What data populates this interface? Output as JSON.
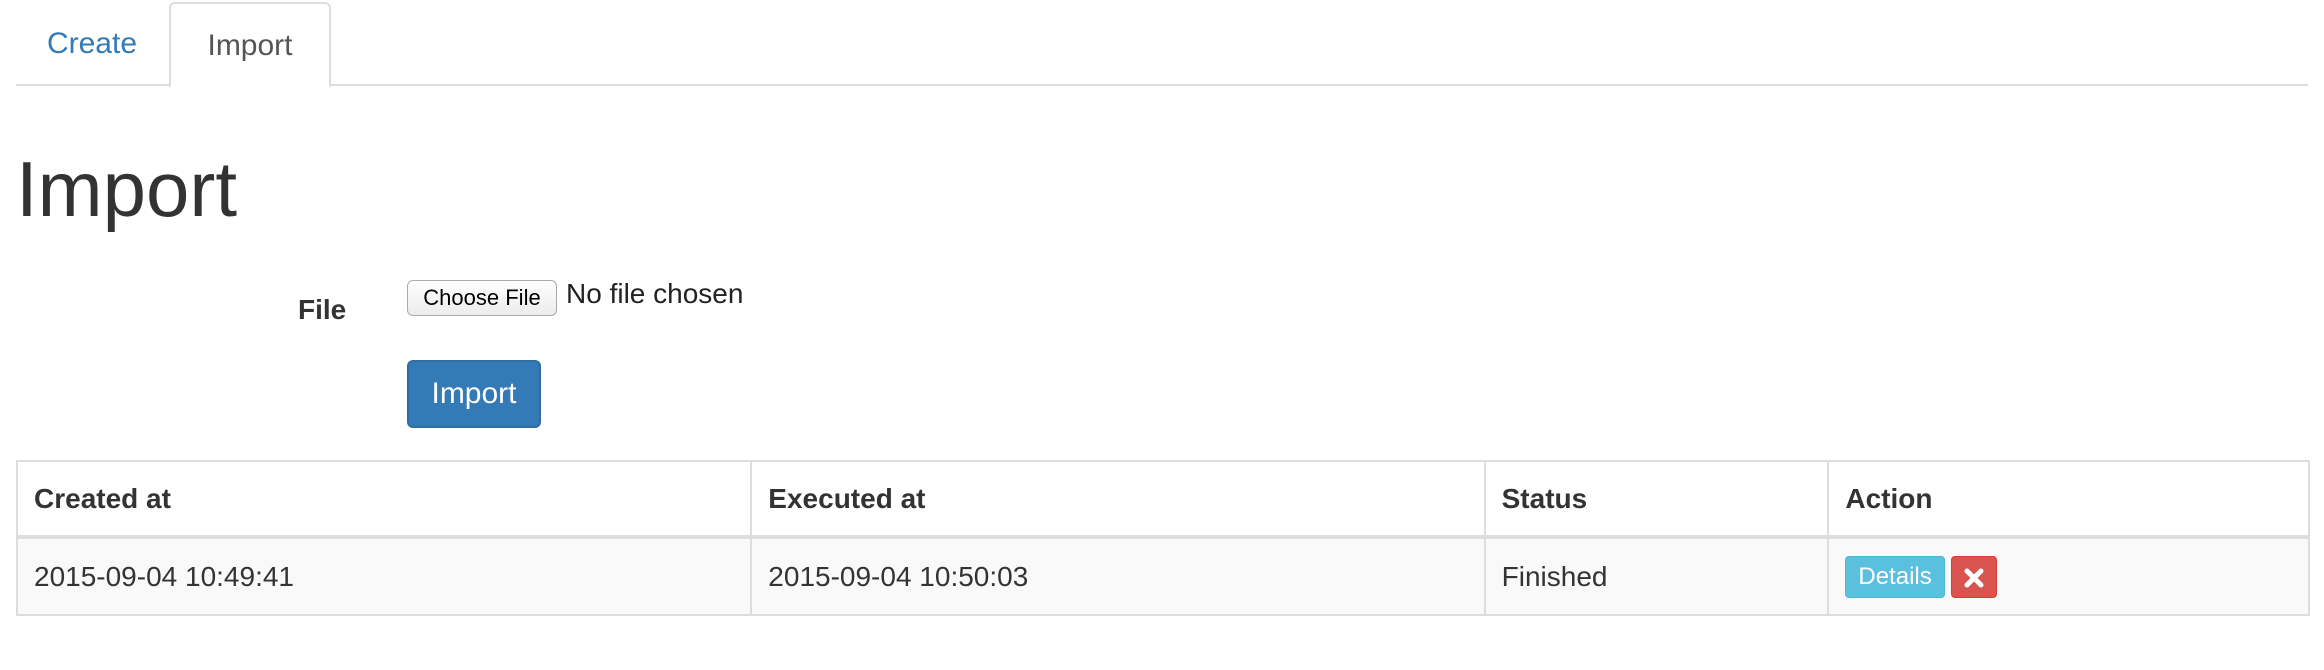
{
  "tabs": [
    {
      "label": "Create",
      "active": false
    },
    {
      "label": "Import",
      "active": true
    }
  ],
  "page_title": "Import",
  "form": {
    "file_label": "File",
    "file_button_label": "Choose File",
    "file_status": "No file chosen",
    "submit_label": "Import"
  },
  "table": {
    "headers": [
      "Created at",
      "Executed at",
      "Status",
      "Action"
    ],
    "rows": [
      {
        "created_at": "2015-09-04 10:49:41",
        "executed_at": "2015-09-04 10:50:03",
        "status": "Finished",
        "details_label": "Details",
        "delete_icon": "close-icon"
      }
    ]
  },
  "colors": {
    "link": "#337ab7",
    "primary": "#337ab7",
    "info": "#5bc0de",
    "danger": "#d9534f"
  }
}
